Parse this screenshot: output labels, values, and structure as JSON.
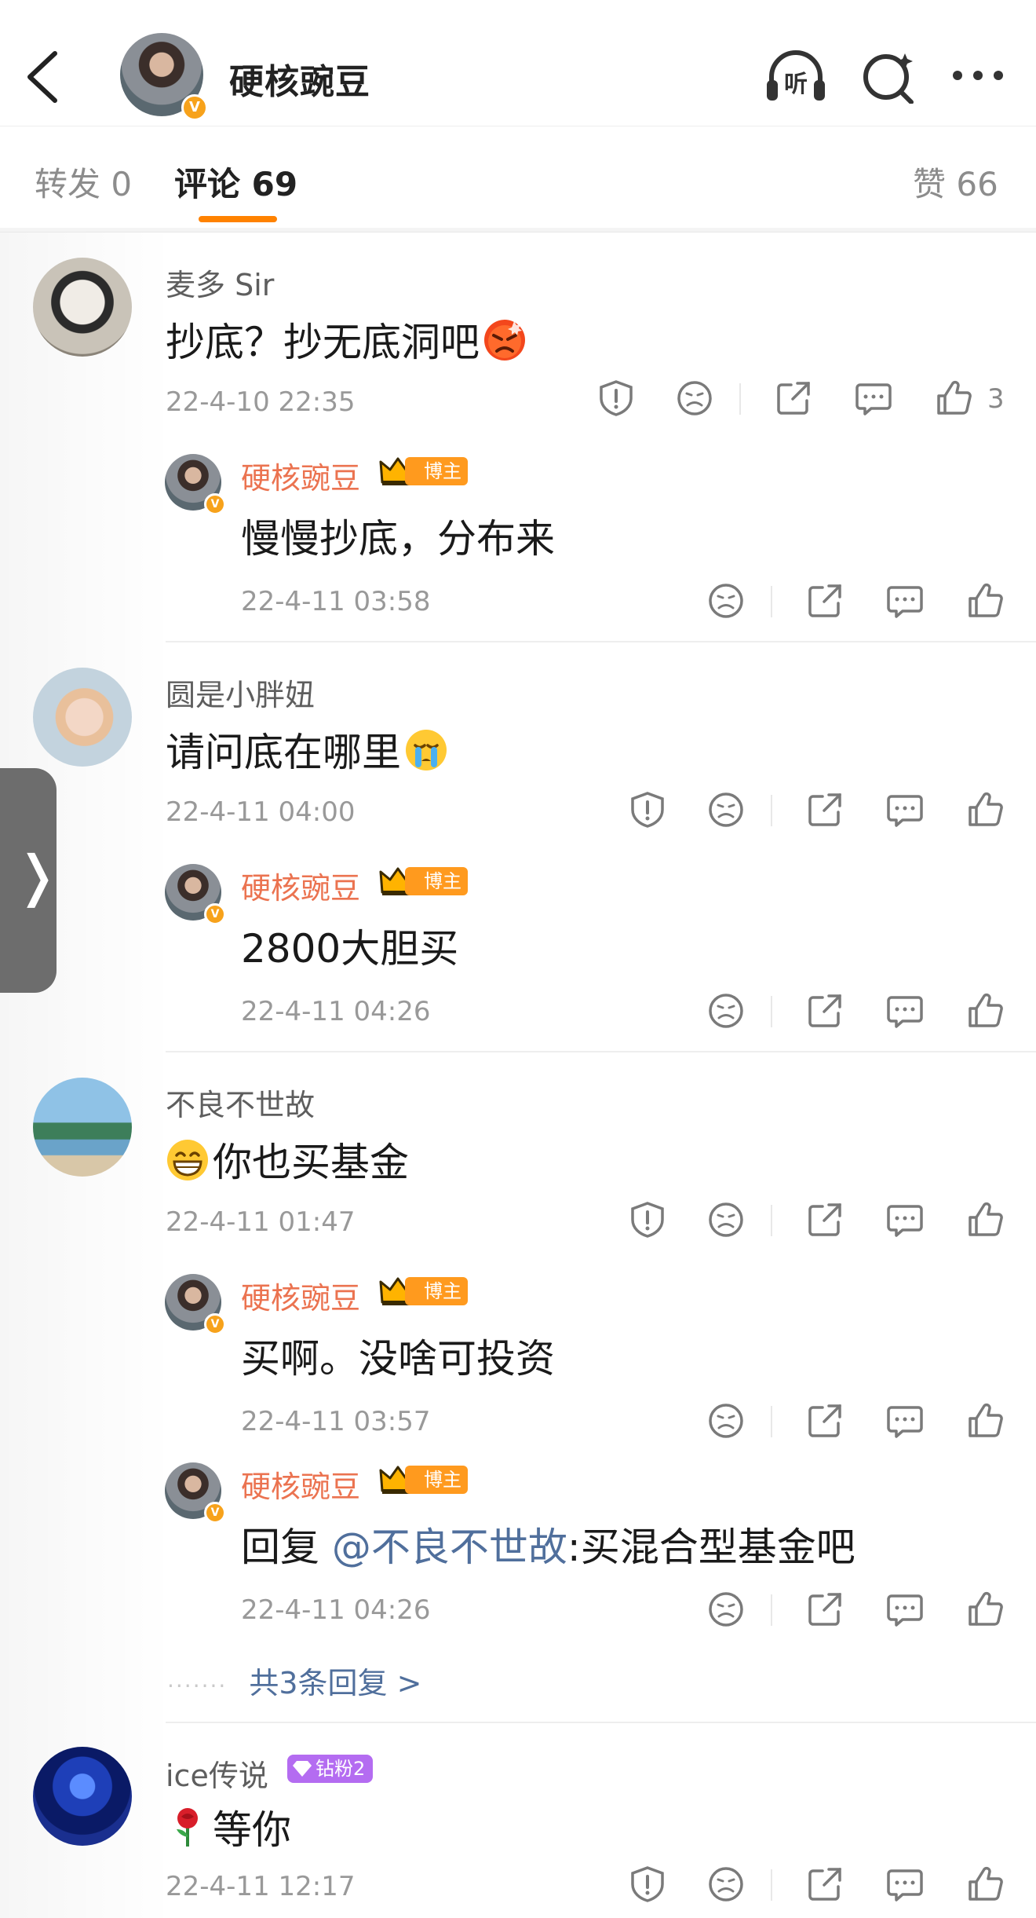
{
  "header": {
    "title": "硬核豌豆",
    "verified_mark": "V",
    "listen_label": "听",
    "icons": [
      "back-chevron-icon",
      "listen-headphones-icon",
      "ai-search-icon",
      "more-dots-icon"
    ]
  },
  "tabs": {
    "repost": "转发 0",
    "comments": "评论 69",
    "likes": "赞 66"
  },
  "badges": {
    "blogger": "博主",
    "diamond_fan": "钻粉2"
  },
  "colors": {
    "accent": "#ff8200",
    "reply_name": "#eb7350",
    "mention": "#506f9c",
    "diamond": "#b46cf1"
  },
  "comments": [
    {
      "user": "麦多 Sir",
      "text": "抄底？抄无底洞吧",
      "emoji": "angry-emoji",
      "time": "22-4-10 22:35",
      "likes": "3",
      "replies": [
        {
          "user": "硬核豌豆",
          "text": "慢慢抄底，分布来",
          "time": "22-4-11 03:58"
        }
      ]
    },
    {
      "user": "圆是小胖妞",
      "text": "请问底在哪里",
      "emoji": "crying-emoji",
      "time": "22-4-11 04:00",
      "replies": [
        {
          "user": "硬核豌豆",
          "text": "2800大胆买",
          "time": "22-4-11 04:26"
        }
      ]
    },
    {
      "user": "不良不世故",
      "text": "你也买基金",
      "emoji": "grin-emoji",
      "time": "22-4-11 01:47",
      "replies": [
        {
          "user": "硬核豌豆",
          "text": "买啊。没啥可投资",
          "time": "22-4-11 03:57"
        },
        {
          "user": "硬核豌豆",
          "prefix": "回复 ",
          "mention": "@不良不世故",
          "text": ":买混合型基金吧",
          "time": "22-4-11 04:26"
        }
      ],
      "more_replies": "共3条回复 >"
    },
    {
      "user": "ice传说",
      "text": "等你",
      "emoji": "rose-emoji",
      "time": "22-4-11 12:17"
    }
  ]
}
